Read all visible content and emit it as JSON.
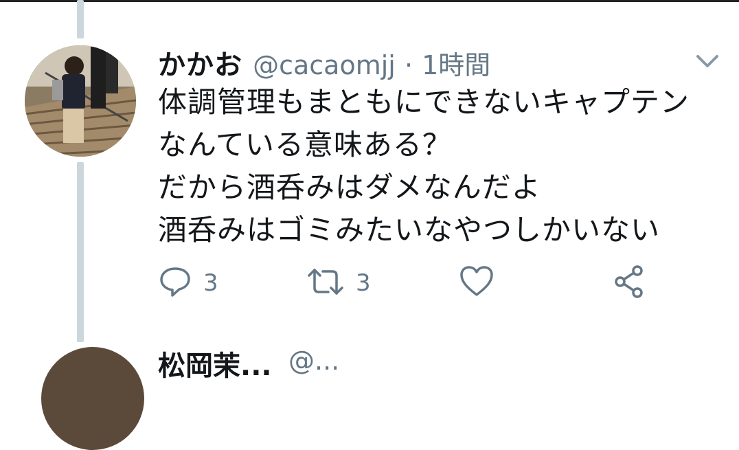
{
  "tweet": {
    "display_name": "かかお",
    "handle": "@cacaomjj",
    "separator": "·",
    "time": "1時間",
    "lines": [
      "体調管理もまともにできないキャプテン",
      "なんている意味ある？",
      "だから酒呑みはダメなんだよ",
      "酒呑みはゴミみたいなやつしかいない"
    ],
    "actions": {
      "reply_count": "3",
      "retweet_count": "3"
    },
    "icons": [
      "chevron-down-icon",
      "reply-icon",
      "retweet-icon",
      "like-icon",
      "share-icon"
    ],
    "colors": {
      "text": "#14171a",
      "secondary": "#657786",
      "thread_line": "#ccd6dd"
    }
  },
  "next_tweet": {
    "display_name": "松岡茉...",
    "handle": "@..."
  }
}
